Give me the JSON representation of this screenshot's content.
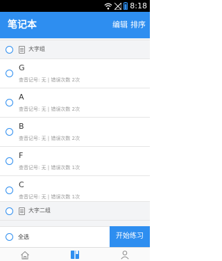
{
  "status_bar": {
    "time": "8:18"
  },
  "app_bar": {
    "title": "笔记本",
    "edit_label": "编辑",
    "sort_label": "排序"
  },
  "groups": [
    {
      "name": "大字组",
      "items": [
        {
          "letter": "G",
          "meta": "查音记号: 无 | 错误次数 2次"
        },
        {
          "letter": "A",
          "meta": "查音记号: 无 | 错误次数 2次"
        },
        {
          "letter": "B",
          "meta": "查音记号: 无 | 错误次数 2次"
        },
        {
          "letter": "F",
          "meta": "查音记号: 无 | 错误次数 1次"
        },
        {
          "letter": "C",
          "meta": "查音记号: 无 | 错误次数 1次"
        }
      ]
    },
    {
      "name": "大字二组",
      "items": []
    }
  ],
  "bottom_bar": {
    "select_all_label": "全选",
    "start_label": "开始练习"
  },
  "tabs": [
    {
      "icon": "home-icon",
      "active": false
    },
    {
      "icon": "notebook-icon",
      "active": true
    },
    {
      "icon": "person-icon",
      "active": false
    }
  ],
  "colors": {
    "accent": "#2e8ef0",
    "background": "#f3f4f6",
    "status_bar": "#000000"
  }
}
